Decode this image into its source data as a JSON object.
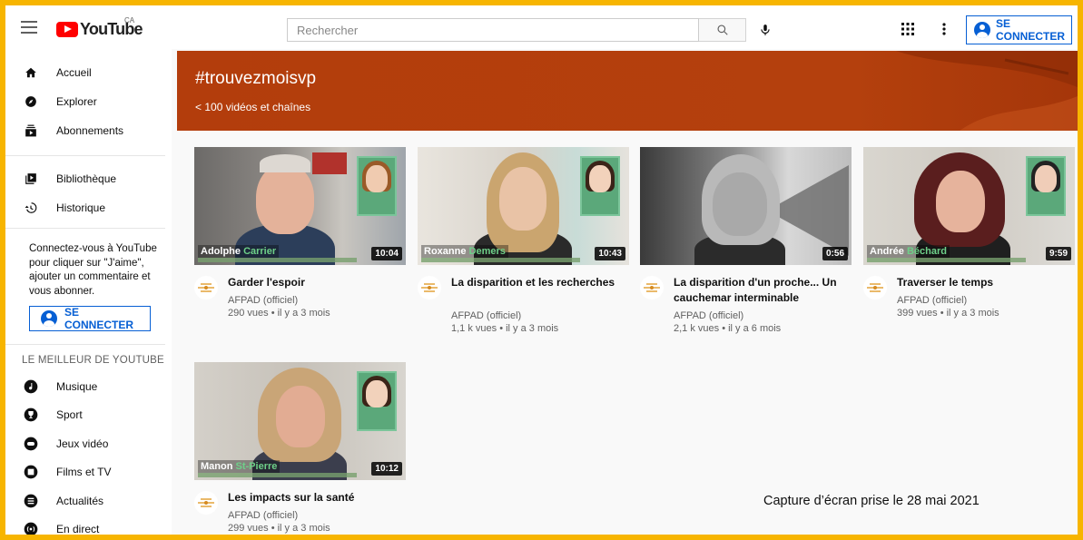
{
  "header": {
    "logo_text": "YouTube",
    "region": "CA",
    "search_placeholder": "Rechercher",
    "signin_label": "SE CONNECTER"
  },
  "sidebar": {
    "items": [
      {
        "label": "Accueil",
        "icon": "home-icon"
      },
      {
        "label": "Explorer",
        "icon": "compass-icon"
      },
      {
        "label": "Abonnements",
        "icon": "subscriptions-icon"
      },
      {
        "label": "Bibliothèque",
        "icon": "library-icon"
      },
      {
        "label": "Historique",
        "icon": "history-icon"
      }
    ],
    "note": "Connectez-vous à YouTube pour cliquer sur \"J'aime\", ajouter un commentaire et vous abonner.",
    "signin_label": "SE CONNECTER",
    "section_title": "LE MEILLEUR DE YOUTUBE",
    "best_of": [
      {
        "label": "Musique",
        "icon": "music-icon"
      },
      {
        "label": "Sport",
        "icon": "trophy-icon"
      },
      {
        "label": "Jeux vidéo",
        "icon": "gaming-icon"
      },
      {
        "label": "Films et TV",
        "icon": "film-icon"
      },
      {
        "label": "Actualités",
        "icon": "news-icon"
      },
      {
        "label": "En direct",
        "icon": "live-icon"
      }
    ]
  },
  "banner": {
    "title": "#trouvezmoisvp",
    "subtitle": "< 100 vidéos et chaînes",
    "color": "#b33d0c"
  },
  "videos": [
    {
      "title": "Garder l'espoir",
      "channel": "AFPAD (officiel)",
      "meta": "290 vues • il y a 3 mois",
      "duration": "10:04",
      "name_first": "Adolphe",
      "name_last": "Carrier"
    },
    {
      "title": "La disparition et les recherches",
      "channel": "AFPAD (officiel)",
      "meta": "1,1 k vues • il y a 3 mois",
      "duration": "10:43",
      "name_first": "Roxanne",
      "name_last": "Demers"
    },
    {
      "title": "La disparition d'un proche... Un cauchemar interminable",
      "channel": "AFPAD (officiel)",
      "meta": "2,1 k vues • il y a 6 mois",
      "duration": "0:56",
      "name_first": "",
      "name_last": ""
    },
    {
      "title": "Traverser le temps",
      "channel": "AFPAD (officiel)",
      "meta": "399 vues • il y a 3 mois",
      "duration": "9:59",
      "name_first": "Andrée",
      "name_last": "Béchard"
    },
    {
      "title": "Les impacts sur la santé",
      "channel": "AFPAD (officiel)",
      "meta": "299 vues • il y a 3 mois",
      "duration": "10:12",
      "name_first": "Manon",
      "name_last": "St-Pierre"
    }
  ],
  "footnote": "Capture d’écran prise le 28 mai 2021",
  "colors": {
    "accent": "#065fd4",
    "brand": "#ff0000",
    "frame": "#f7b500"
  }
}
